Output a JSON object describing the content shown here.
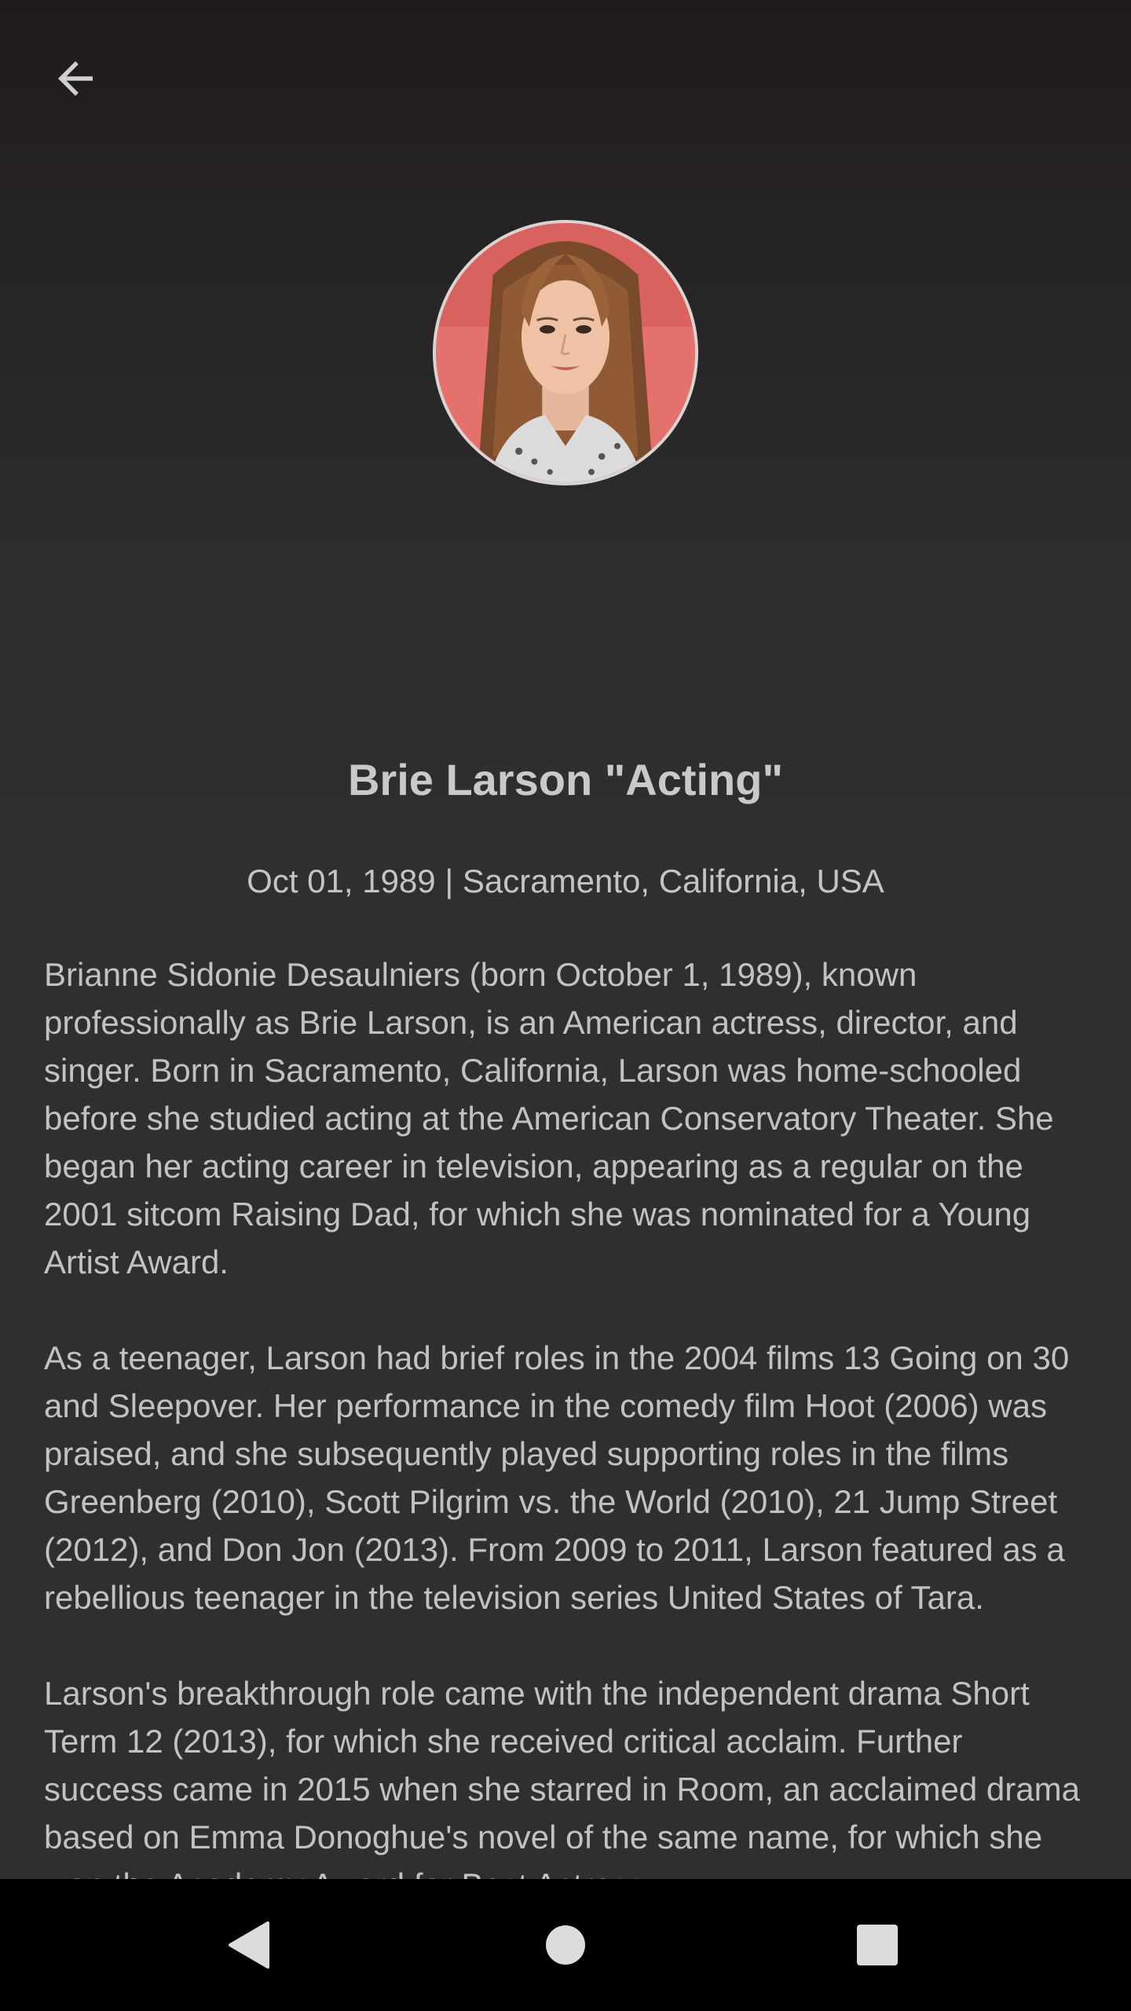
{
  "header": {
    "back_icon": "arrow-left-icon"
  },
  "profile": {
    "name": "Brie Larson \"Acting\"",
    "meta": "Oct 01, 1989 | Sacramento, California, USA",
    "bio": [
      "Brianne Sidonie Desaulniers (born October 1, 1989), known professionally as Brie Larson, is an American actress, director, and singer. Born in Sacramento, California, Larson was home-schooled before she studied acting at the American Conservatory Theater. She began her acting career in television, appearing as a regular on the 2001 sitcom Raising Dad, for which she was nominated for a Young Artist Award.",
      "As a teenager, Larson had brief roles in the 2004 films 13 Going on 30 and Sleepover. Her performance in the comedy film Hoot (2006) was praised, and she subsequently played supporting roles in the films Greenberg (2010), Scott Pilgrim vs. the World (2010), 21 Jump Street (2012), and Don Jon (2013). From 2009 to 2011, Larson featured as a rebellious teenager in the television series United States of Tara.",
      "Larson's breakthrough role came with the independent drama Short Term 12 (2013), for which she received critical acclaim. Further success came in 2015 when she starred in Room, an acclaimed drama based on Emma Donoghue's novel of the same name, for which she won the Academy Award for Best Actress."
    ]
  },
  "nav": {
    "back_icon": "triangle-back-icon",
    "home_icon": "circle-home-icon",
    "recents_icon": "square-recents-icon"
  },
  "colors": {
    "background": "#2f2f2f",
    "text": "#c2c2c2",
    "nav_background": "#000000"
  }
}
